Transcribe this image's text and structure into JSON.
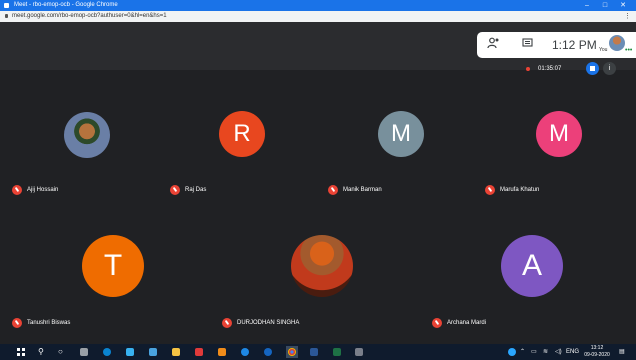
{
  "browser": {
    "window_title": "Meet - rbo-emop-ocb - Google Chrome",
    "url": "meet.google.com/rbo-emop-ocb?authuser=0&hl=en&hs=1",
    "minimize": "–",
    "maximize": "□",
    "close": "✕"
  },
  "toolbar": {
    "people_icon": "people-icon",
    "chat_icon": "chat-icon",
    "time": "1:12 PM",
    "self_label": "You"
  },
  "recording": {
    "elapsed": "01:35:07"
  },
  "participants": [
    {
      "name": "Ajij Hossain",
      "initial": "",
      "color": ""
    },
    {
      "name": "Raj Das",
      "initial": "R",
      "color": "#e8471f"
    },
    {
      "name": "Manik Barman",
      "initial": "M",
      "color": "#78909c"
    },
    {
      "name": "Marufa Khatun",
      "initial": "M",
      "color": "#ec407a"
    },
    {
      "name": "Tanushri Biswas",
      "initial": "T",
      "color": "#ef6c00"
    },
    {
      "name": "DURJODHAN SINGHA",
      "initial": "",
      "color": ""
    },
    {
      "name": "Archana Mardi",
      "initial": "A",
      "color": "#7e57c2"
    }
  ],
  "taskbar": {
    "language": "ENG",
    "time": "13:12",
    "date": "09-09-2020"
  }
}
